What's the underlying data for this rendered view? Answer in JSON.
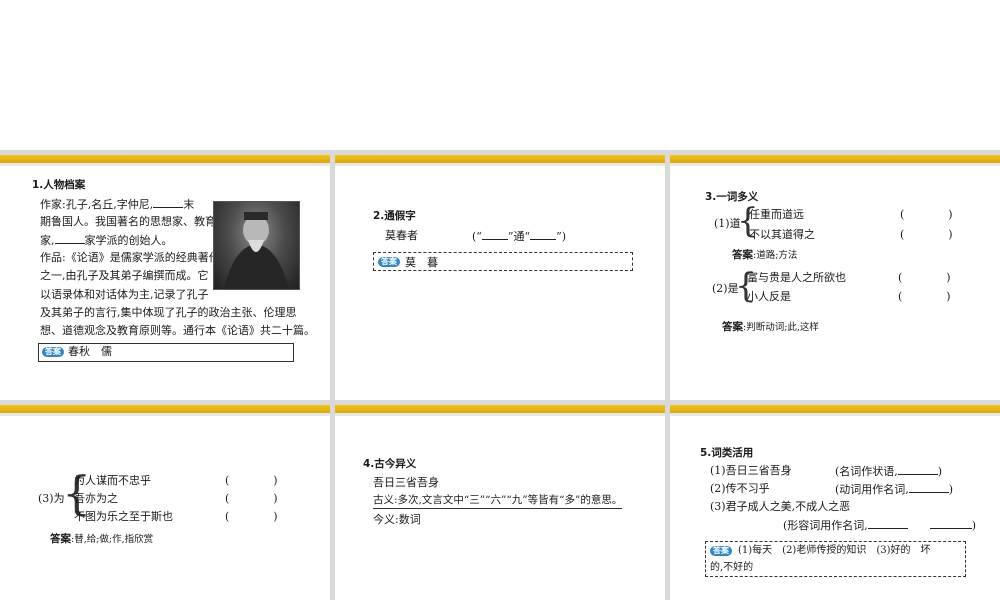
{
  "slide1": {
    "title": "1.人物档案",
    "l1a": "作家:孔子,名丘,字仲尼,",
    "l1b": "末",
    "l2": "期鲁国人。我国著名的思想家、教育",
    "l3a": "家,",
    "l3b": "家学派的创始人。",
    "l4": "作品:《论语》是儒家学派的经典著作",
    "l5": "之一,由孔子及其弟子编撰而成。它",
    "l6": "以语录体和对话体为主,记录了孔子",
    "l7": "及其弟子的言行,集中体现了孔子的政治主张、伦理思",
    "l8": "想、道德观念及教育原则等。通行本《论语》共二十篇。",
    "tag": "答案",
    "answer": "春秋　儒"
  },
  "slide2": {
    "title": "2.通假字",
    "word": "莫春者",
    "hint_open": "(“",
    "hint_mid": "”通“",
    "hint_close": "”)",
    "tag": "答案",
    "answer": "莫　暮"
  },
  "slide3": {
    "title": "3.一词多义",
    "g1_label": "(1)道",
    "g1_a": "任重而道远",
    "g1_b": "不以其道得之",
    "paren": "(　　　　)",
    "ans1_label": "答案",
    "ans1": ":道路;方法",
    "g2_label": "(2)是",
    "g2_a": "富与贵是人之所欲也",
    "g2_b": "小人反是",
    "ans2_label": "答案",
    "ans2": ":判断动词;此,这样"
  },
  "slide4": {
    "g_label": "(3)为",
    "a": "为人谋而不忠乎",
    "b": "吾亦为之",
    "c": "不图为乐之至于斯也",
    "paren": "(　　　　)",
    "ans_label": "答案",
    "ans": ":替,给;做;作,指欣赏"
  },
  "slide5": {
    "title": "4.古今异义",
    "line1": "吾日三省吾身",
    "line2": "古义:多次,文言文中“三”“六”“九”等皆有“多”的意思。",
    "line3": "今义:数词"
  },
  "slide6": {
    "title": "5.词类活用",
    "i1": "(1)吾日三省吾身",
    "i1h_a": "(名词作状语,",
    "i1h_b": ")",
    "i2": "(2)传不习乎",
    "i2h_a": "(动词用作名词,",
    "i2h_b": ")",
    "i3": "(3)君子成人之美,不成人之恶",
    "i3h_a": "(形容词用作名词,",
    "i3h_b": ")",
    "tag": "答案",
    "ans_a": "(1)每天　(2)老师传授的知识　(3)好的　坏",
    "ans_b": "的,不好的"
  },
  "colors": {
    "bar": "#f2c31a",
    "tag": "#2f86c7"
  }
}
